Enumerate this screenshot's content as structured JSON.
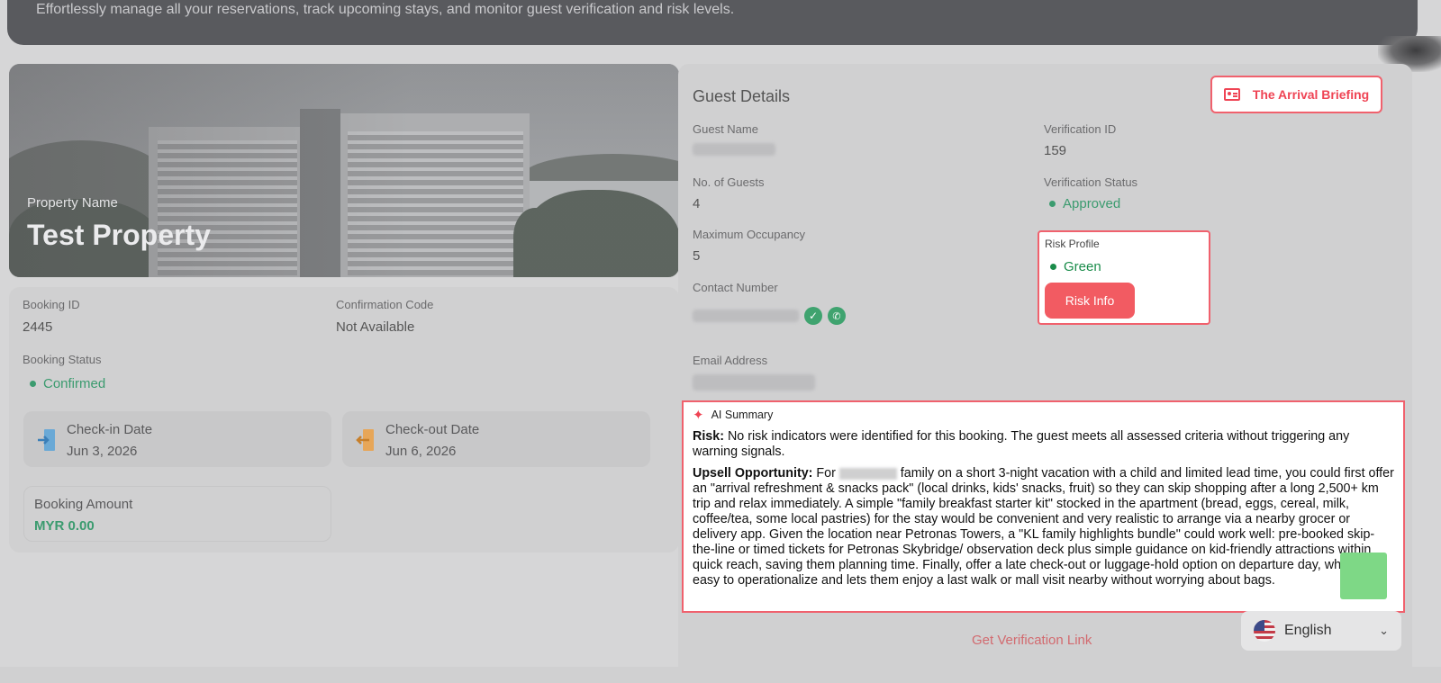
{
  "header": {
    "subtitle": "Effortlessly manage all your reservations, track upcoming stays, and monitor guest verification and risk levels."
  },
  "property": {
    "label": "Property Name",
    "name": "Test Property"
  },
  "booking": {
    "id_label": "Booking ID",
    "id_value": "2445",
    "confirmation_label": "Confirmation Code",
    "confirmation_value": "Not Available",
    "status_label": "Booking Status",
    "status_value": "Confirmed",
    "checkin_label": "Check-in Date",
    "checkin_value": "Jun 3, 2026",
    "checkout_label": "Check-out Date",
    "checkout_value": "Jun 6, 2026",
    "amount_label": "Booking Amount",
    "amount_value": "MYR 0.00"
  },
  "guest": {
    "title": "Guest Details",
    "arrival_button": "The Arrival Briefing",
    "name_label": "Guest Name",
    "guests_label": "No. of Guests",
    "guests_value": "4",
    "max_occ_label": "Maximum Occupancy",
    "max_occ_value": "5",
    "contact_label": "Contact Number",
    "email_label": "Email Address",
    "verification_id_label": "Verification ID",
    "verification_id_value": "159",
    "verification_status_label": "Verification Status",
    "verification_status_value": "Approved",
    "risk_label": "Risk Profile",
    "risk_value": "Green",
    "risk_button": "Risk Info"
  },
  "ai_summary": {
    "title": "AI Summary",
    "risk_heading": "Risk:",
    "risk_text": " No risk indicators were identified for this booking. The guest meets all assessed criteria without triggering any warning signals.",
    "upsell_heading": "Upsell Opportunity:",
    "upsell_pre": " For ",
    "upsell_text": " family on a short 3-night vacation with a child and limited lead time, you could first offer an \"arrival refreshment & snacks pack\" (local drinks, kids' snacks, fruit) so they can skip shopping after a long 2,500+ km trip and relax immediately. A simple \"family breakfast starter kit\" stocked in the apartment (bread, eggs, cereal, milk, coffee/tea, some local pastries) for the stay would be convenient and very realistic to arrange via a nearby grocer or delivery app. Given the location near Petronas Towers, a \"KL family highlights bundle\" could work well: pre-booked skip-the-line or timed tickets for Petronas Skybridge/ observation deck plus simple guidance on kid-friendly attractions within quick reach, saving them planning time. Finally, offer a late check-out or luggage-hold option on departure day, which is easy to operationalize and lets them enjoy a last walk or mall visit nearby without worrying about bags."
  },
  "footer": {
    "get_link": "Get Verification Link",
    "language": "English"
  },
  "colors": {
    "accent": "#ef4454",
    "success": "#3b9b6f"
  }
}
